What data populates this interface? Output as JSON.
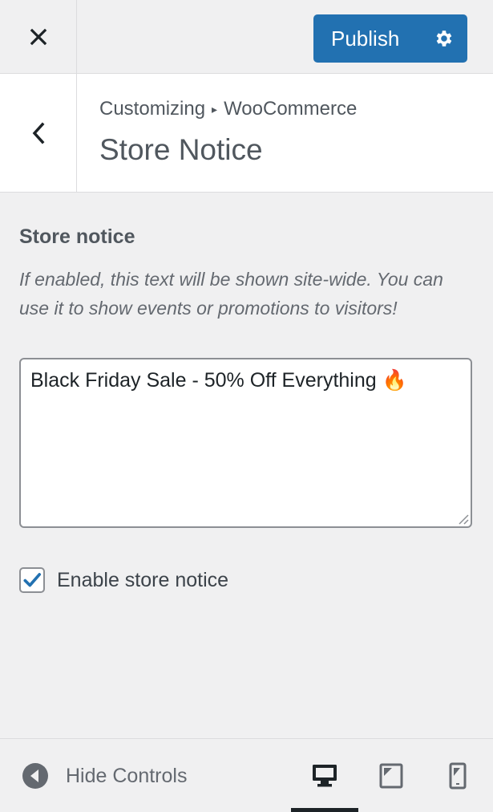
{
  "header": {
    "close_icon": "close-icon",
    "publish_label": "Publish",
    "settings_icon": "gear-icon",
    "accent": "#2271b1"
  },
  "section": {
    "back_icon": "chevron-left-icon",
    "breadcrumb_parent": "Customizing",
    "breadcrumb_separator": "▸",
    "breadcrumb_current": "WooCommerce",
    "title": "Store Notice"
  },
  "control": {
    "label": "Store notice",
    "description": "If enabled, this text will be shown site-wide. You can use it to show events or promotions to visitors!",
    "textarea_value": "Black Friday Sale - 50% Off Everything 🔥",
    "checkbox_checked": true,
    "checkbox_label": "Enable store notice"
  },
  "footer": {
    "hide_controls_label": "Hide Controls",
    "hide_controls_icon": "arrow-left-circle-icon",
    "devices": [
      "desktop",
      "tablet",
      "mobile"
    ],
    "active_device": "desktop"
  }
}
